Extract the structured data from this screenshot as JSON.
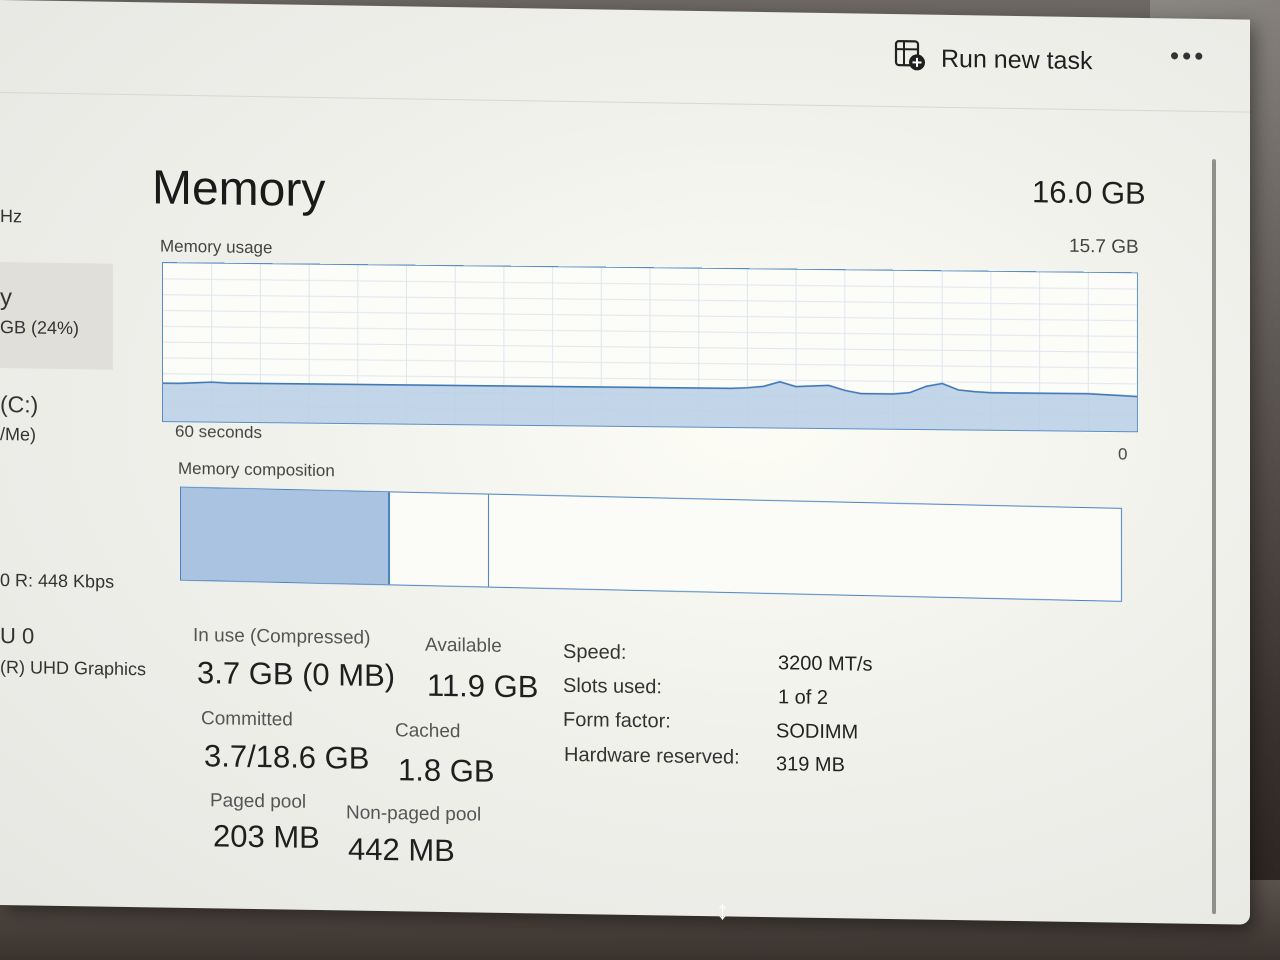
{
  "header": {
    "run_new_task_label": "Run new task",
    "more_label": "•••"
  },
  "sidebar": {
    "fragments": [
      "Hz",
      "y",
      "GB (24%)",
      "(C:)",
      "/Me)",
      "0 R: 448 Kbps",
      "U 0",
      "(R) UHD Graphics"
    ]
  },
  "memory": {
    "title": "Memory",
    "total": "16.0 GB",
    "usage_label": "Memory usage",
    "usage_max": "15.7 GB",
    "time_label": "60 seconds",
    "time_end": "0",
    "composition_label": "Memory composition",
    "composition": {
      "in_use_fraction": 0.22,
      "modified_fraction": 0.105
    },
    "usage_series": [
      0.24,
      0.24,
      0.245,
      0.25,
      0.245,
      0.245,
      0.245,
      0.245,
      0.245,
      0.245,
      0.245,
      0.245,
      0.245,
      0.245,
      0.245,
      0.245,
      0.245,
      0.245,
      0.245,
      0.245,
      0.245,
      0.245,
      0.245,
      0.245,
      0.245,
      0.245,
      0.245,
      0.245,
      0.245,
      0.245,
      0.245,
      0.245,
      0.245,
      0.245,
      0.245,
      0.245,
      0.25,
      0.26,
      0.29,
      0.26,
      0.265,
      0.27,
      0.24,
      0.22,
      0.22,
      0.22,
      0.23,
      0.27,
      0.29,
      0.25,
      0.24,
      0.235,
      0.235,
      0.235,
      0.235,
      0.235,
      0.235,
      0.235,
      0.23,
      0.225,
      0.22
    ],
    "stats": {
      "in_use_label": "In use (Compressed)",
      "in_use_value": "3.7 GB (0 MB)",
      "available_label": "Available",
      "available_value": "11.9 GB",
      "committed_label": "Committed",
      "committed_value": "3.7/18.6 GB",
      "cached_label": "Cached",
      "cached_value": "1.8 GB",
      "paged_label": "Paged pool",
      "paged_value": "203 MB",
      "nonpaged_label": "Non-paged pool",
      "nonpaged_value": "442 MB"
    },
    "specs": {
      "speed_label": "Speed:",
      "speed_value": "3200 MT/s",
      "slots_label": "Slots used:",
      "slots_value": "1 of 2",
      "form_label": "Form factor:",
      "form_value": "SODIMM",
      "reserved_label": "Hardware reserved:",
      "reserved_value": "319 MB"
    }
  },
  "colors": {
    "accent_line": "#3f78b5",
    "fill": "#b9cfe6",
    "in_use_fill": "#a9c3e0"
  }
}
